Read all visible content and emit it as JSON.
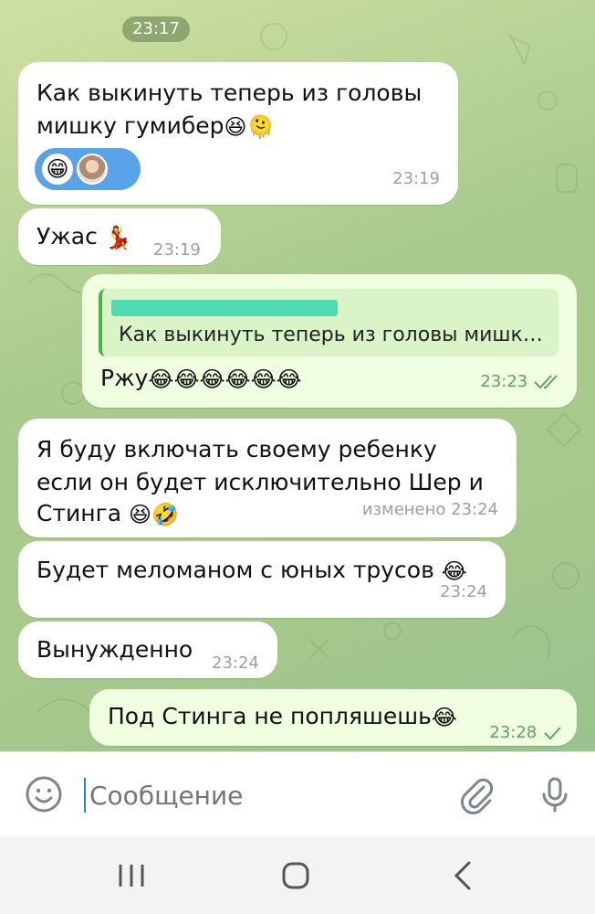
{
  "chat": {
    "date_chip": "23:17",
    "messages": [
      {
        "id": "m1",
        "direction": "in",
        "lines": [
          "Как выкинуть теперь из головы",
          "мишку гумибер"
        ],
        "emojis": [
          "😆",
          "🫠"
        ],
        "reactions": [
          "😁"
        ],
        "time": "23:19"
      },
      {
        "id": "m2",
        "direction": "in",
        "text": "Ужас",
        "emojis": [
          "💃"
        ],
        "time": "23:19"
      },
      {
        "id": "m3",
        "direction": "out",
        "reply_text": "Как выкинуть теперь из головы мишк…",
        "text": "Ржу",
        "emojis": [
          "😂",
          "😂",
          "😂",
          "😂",
          "😂",
          "😂"
        ],
        "time": "23:23",
        "status": "read"
      },
      {
        "id": "m4",
        "direction": "in",
        "lines": [
          "Я буду включать своему ребенку",
          "если он будет исключительно Шер и",
          "Стинга"
        ],
        "emojis": [
          "😆",
          "🤣"
        ],
        "time": "изменено 23:24"
      },
      {
        "id": "m5",
        "direction": "in",
        "text": "Будет меломаном с юных трусов",
        "emojis": [
          "😂"
        ],
        "time": "23:24"
      },
      {
        "id": "m6",
        "direction": "in",
        "text": "Вынужденно",
        "time": "23:24"
      },
      {
        "id": "m7",
        "direction": "out",
        "text": "Под Стинга не попляшешь",
        "emojis": [
          "😂"
        ],
        "time": "23:28",
        "status": "sent"
      }
    ]
  },
  "input": {
    "placeholder": "Сообщение",
    "value": ""
  },
  "icons": {
    "emoji": "emoji-smile-icon",
    "attach": "paperclip-icon",
    "mic": "microphone-icon",
    "recent": "recent-apps-icon",
    "home": "home-icon",
    "back": "back-icon"
  },
  "colors": {
    "incoming_bubble": "#ffffff",
    "outgoing_bubble": "#efffdf",
    "accent_green": "#4caf50",
    "reaction_blue": "#5aa3e8",
    "caret_blue": "#2f7fd6"
  }
}
